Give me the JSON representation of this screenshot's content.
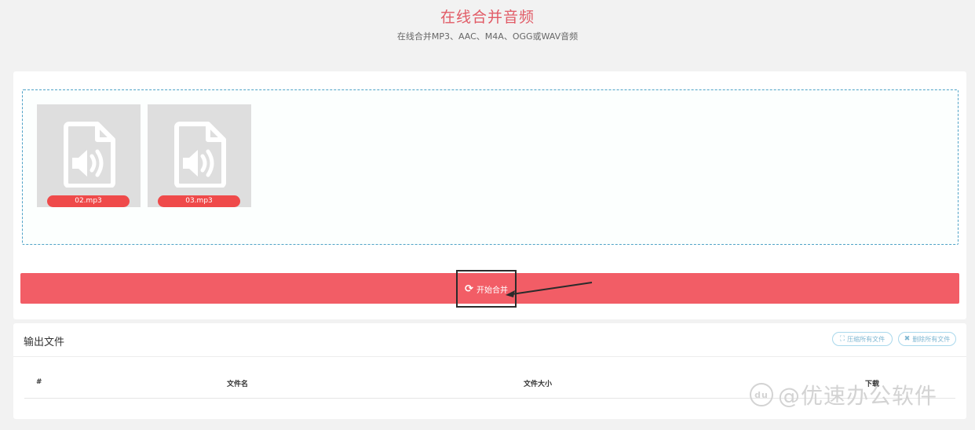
{
  "header": {
    "title": "在线合并音频",
    "subtitle": "在线合并MP3、AAC、M4A、OGG或WAV音频"
  },
  "files": [
    {
      "name": "02.mp3",
      "icon": "audio-file-icon"
    },
    {
      "name": "03.mp3",
      "icon": "audio-file-icon"
    }
  ],
  "merge": {
    "label": "开始合并",
    "icon": "refresh-icon",
    "color": "#f25d66"
  },
  "output": {
    "title": "输出文件",
    "compress_all_label": "压缩所有文件",
    "clear_all_label": "删除所有文件",
    "columns": [
      "#",
      "文件名",
      "文件大小",
      "下载"
    ]
  },
  "watermark": {
    "text": "@优速办公软件",
    "logo": "du"
  }
}
